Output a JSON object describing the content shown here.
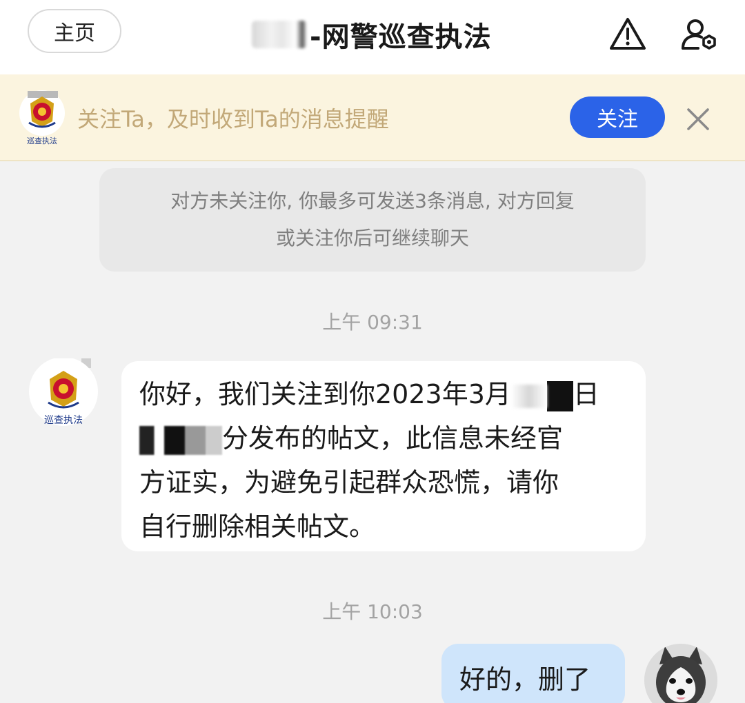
{
  "header": {
    "home_label": "主页",
    "title": "-网警巡查执法",
    "warning_icon": "warning-triangle-icon",
    "profile_icon": "user-settings-icon"
  },
  "banner": {
    "avatar_caption": "巡查执法",
    "text": "关注Ta，及时收到Ta的消息提醒",
    "follow_label": "关注",
    "close_icon": "close-icon"
  },
  "notice": {
    "line1": "对方未关注你, 你最多可发送3条消息, 对方回复",
    "line2": "或关注你后可继续聊天"
  },
  "messages": {
    "time1": "上午 09:31",
    "incoming": {
      "avatar_caption": "巡查执法",
      "line1_a": "你好，我们关注到你2023年3月",
      "line1_b": "日",
      "line2_b": "分发布的帖文，此信息未经官",
      "line3": "方证实，为避免引起群众恐慌，请你",
      "line4": "自行删除相关帖文。"
    },
    "time2": "上午 10:03",
    "outgoing": {
      "text": "好的，删了"
    }
  },
  "colors": {
    "accent": "#2b63e8",
    "banner_bg": "#fbf4df",
    "banner_text": "#c2a878",
    "outgoing_bubble": "#cfe5fb",
    "background": "#f2f2f2"
  }
}
